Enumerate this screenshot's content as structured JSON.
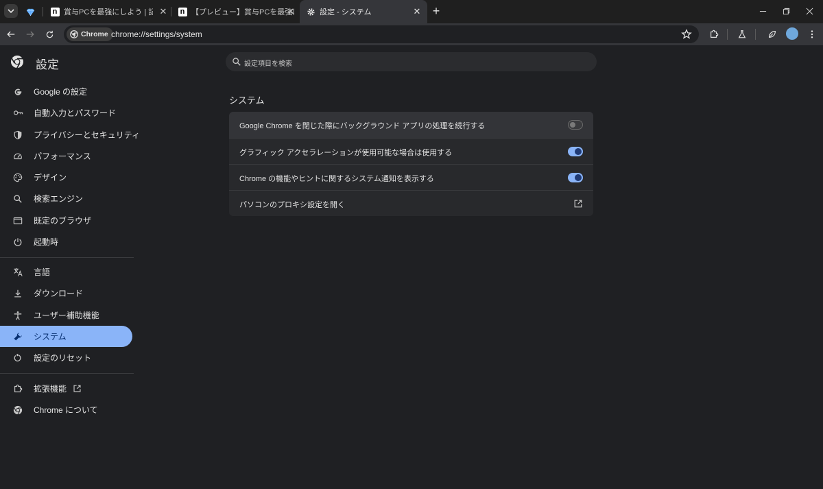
{
  "tabs": {
    "pinned_icon": "gem-icon",
    "items": [
      {
        "title": "賞与PCを最強にしよう | 記事編集",
        "favicon": "note-n-icon"
      },
      {
        "title": "【プレビュー】賞与PCを最強にしよう",
        "favicon": "note-n-icon"
      },
      {
        "title": "設定 - システム",
        "favicon": "gear-icon"
      }
    ],
    "new_tab": "+"
  },
  "toolbar": {
    "chip_label": "Chrome",
    "url": "chrome://settings/system"
  },
  "sidebar": {
    "title": "設定",
    "items": [
      {
        "label": "Google の設定",
        "icon": "google-g-icon"
      },
      {
        "label": "自動入力とパスワード",
        "icon": "key-icon"
      },
      {
        "label": "プライバシーとセキュリティ",
        "icon": "shield-icon"
      },
      {
        "label": "パフォーマンス",
        "icon": "speedometer-icon"
      },
      {
        "label": "デザイン",
        "icon": "palette-icon"
      },
      {
        "label": "検索エンジン",
        "icon": "search-icon"
      },
      {
        "label": "既定のブラウザ",
        "icon": "browser-window-icon"
      },
      {
        "label": "起動時",
        "icon": "power-icon"
      },
      {
        "label": "言語",
        "icon": "translate-icon"
      },
      {
        "label": "ダウンロード",
        "icon": "download-icon"
      },
      {
        "label": "ユーザー補助機能",
        "icon": "accessibility-icon"
      },
      {
        "label": "システム",
        "icon": "wrench-icon"
      },
      {
        "label": "設定のリセット",
        "icon": "reset-icon"
      },
      {
        "label": "拡張機能",
        "icon": "puzzle-icon"
      },
      {
        "label": "Chrome について",
        "icon": "chrome-icon"
      }
    ],
    "active_item": "システム"
  },
  "main": {
    "search_placeholder": "設定項目を検索",
    "section_title": "システム",
    "rows": [
      {
        "label": "Google Chrome を閉じた際にバックグラウンド アプリの処理を続行する",
        "control": "toggle",
        "value": false
      },
      {
        "label": "グラフィック アクセラレーションが使用可能な場合は使用する",
        "control": "toggle",
        "value": true
      },
      {
        "label": "Chrome の機能やヒントに関するシステム通知を表示する",
        "control": "toggle",
        "value": true
      },
      {
        "label": "パソコンのプロキシ設定を開く",
        "control": "external-link",
        "value": null
      }
    ]
  },
  "colors": {
    "accent": "#8ab4f8",
    "background": "#1f2023",
    "card": "#28292c"
  }
}
